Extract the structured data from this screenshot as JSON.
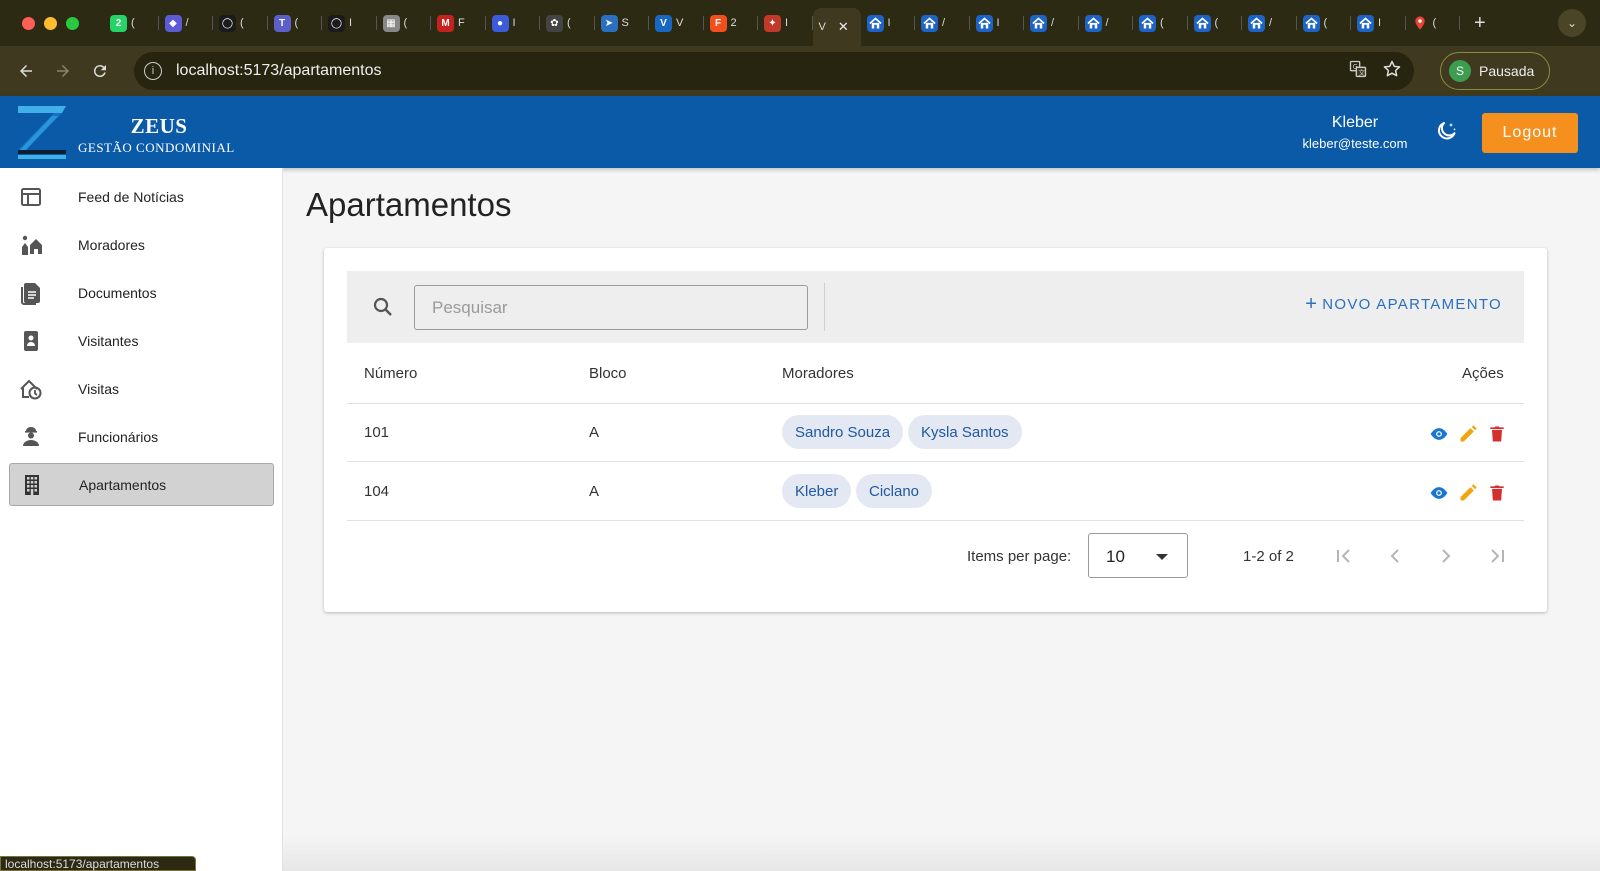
{
  "browser": {
    "tabs": [
      {
        "icon": "whatsapp-icon",
        "color": "#25d366",
        "glyph": "2",
        "text": "("
      },
      {
        "icon": "app-tab-icon",
        "color": "#5b5bd6",
        "glyph": "◆",
        "text": "/"
      },
      {
        "icon": "github-icon",
        "color": "#1b1b1b",
        "glyph": "◯",
        "text": "("
      },
      {
        "icon": "teams-icon",
        "color": "#5b5fc7",
        "glyph": "T",
        "text": "("
      },
      {
        "icon": "github-icon",
        "color": "#1b1b1b",
        "glyph": "◯",
        "text": "I"
      },
      {
        "icon": "building-tab-icon",
        "color": "#888888",
        "glyph": "▦",
        "text": "("
      },
      {
        "icon": "gmail-icon",
        "color": "#c5221f",
        "glyph": "M",
        "text": "F"
      },
      {
        "icon": "app-tab-icon",
        "color": "#3b5bdb",
        "glyph": "●",
        "text": "I"
      },
      {
        "icon": "chatgpt-icon",
        "color": "#444444",
        "glyph": "✿",
        "text": "("
      },
      {
        "icon": "app-tab-icon",
        "color": "#2b6fbf",
        "glyph": "➤",
        "text": "S"
      },
      {
        "icon": "vuetify-icon",
        "color": "#1867c0",
        "glyph": "V",
        "text": "V"
      },
      {
        "icon": "figma-icon",
        "color": "#f24e1e",
        "glyph": "F",
        "text": "2"
      },
      {
        "icon": "app-tab-icon",
        "color": "#c0392b",
        "glyph": "✦",
        "text": "I"
      }
    ],
    "active_tab": {
      "text": "V",
      "close": "✕"
    },
    "home_tabs": [
      {
        "icon": "home-tab-icon",
        "text": "I"
      },
      {
        "icon": "home-tab-icon",
        "text": "/"
      },
      {
        "icon": "home-tab-icon",
        "text": "I"
      },
      {
        "icon": "home-tab-icon",
        "text": "/"
      },
      {
        "icon": "home-tab-icon",
        "text": "/"
      },
      {
        "icon": "home-tab-icon",
        "text": "("
      },
      {
        "icon": "home-tab-icon",
        "text": "("
      },
      {
        "icon": "home-tab-icon",
        "text": "/"
      },
      {
        "icon": "home-tab-icon",
        "text": "("
      },
      {
        "icon": "home-tab-icon",
        "text": "I"
      },
      {
        "icon": "maps-tab-icon",
        "text": "("
      }
    ],
    "new_tab": "+",
    "url": "localhost:5173/apartamentos",
    "profile_initial": "S",
    "profile_label": "Pausada",
    "status_url": "localhost:5173/apartamentos"
  },
  "header": {
    "brand_name": "ZEUS",
    "brand_sub": "GESTÃO CONDOMINIAL",
    "user_name": "Kleber",
    "user_email": "kleber@teste.com",
    "logout_label": "Logout"
  },
  "sidebar": {
    "items": [
      {
        "label": "Feed de Notícias",
        "icon": "news-feed-icon"
      },
      {
        "label": "Moradores",
        "icon": "residents-icon"
      },
      {
        "label": "Documentos",
        "icon": "document-icon"
      },
      {
        "label": "Visitantes",
        "icon": "visitor-badge-icon"
      },
      {
        "label": "Visitas",
        "icon": "visit-history-icon"
      },
      {
        "label": "Funcionários",
        "icon": "employee-icon"
      },
      {
        "label": "Apartamentos",
        "icon": "building-icon",
        "active": true
      }
    ]
  },
  "main": {
    "title": "Apartamentos",
    "search_placeholder": "Pesquisar",
    "new_button": "NOVO APARTAMENTO",
    "columns": [
      "Número",
      "Bloco",
      "Moradores",
      "Ações"
    ],
    "rows": [
      {
        "numero": "101",
        "bloco": "A",
        "moradores": [
          "Sandro Souza",
          "Kysla Santos"
        ]
      },
      {
        "numero": "104",
        "bloco": "A",
        "moradores": [
          "Kleber",
          "Ciclano"
        ]
      }
    ],
    "pagination": {
      "label": "Items per page:",
      "per_page": "10",
      "range": "1-2 of 2"
    }
  },
  "colors": {
    "appbar": "#0a5aa8",
    "logout": "#f5901f",
    "view": "#1976d2",
    "edit": "#f2a60d",
    "delete": "#d32f2f",
    "chip_text": "#1f5aa0"
  }
}
